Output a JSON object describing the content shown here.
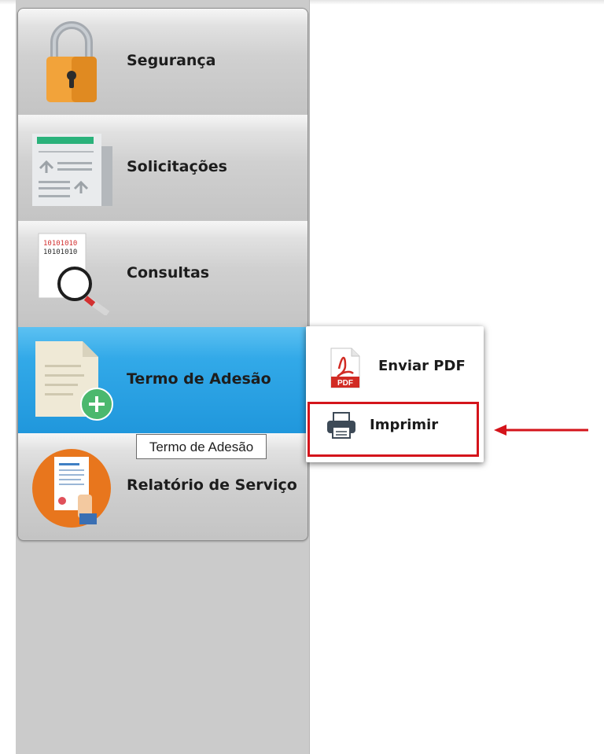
{
  "menu": {
    "items": [
      {
        "label": "Segurança",
        "icon": "padlock-icon"
      },
      {
        "label": "Solicitações",
        "icon": "document-list-icon"
      },
      {
        "label": "Consultas",
        "icon": "binary-magnifier-icon"
      },
      {
        "label": "Termo de Adesão",
        "icon": "document-add-icon",
        "active": true
      },
      {
        "label": "Relatório de Serviço",
        "icon": "report-certificate-icon"
      }
    ]
  },
  "tooltip": {
    "text": "Termo de Adesão"
  },
  "submenu": {
    "items": [
      {
        "label": "Enviar PDF",
        "icon": "pdf-icon",
        "icon_text": "PDF"
      },
      {
        "label": "Imprimir",
        "icon": "printer-icon",
        "highlighted": true
      }
    ]
  },
  "annotation": {
    "arrow_color": "#d4141b"
  },
  "colors": {
    "active_item": "#2a9fe2",
    "sidebar": "#cbcbcb",
    "highlight_border": "#d4141b"
  }
}
